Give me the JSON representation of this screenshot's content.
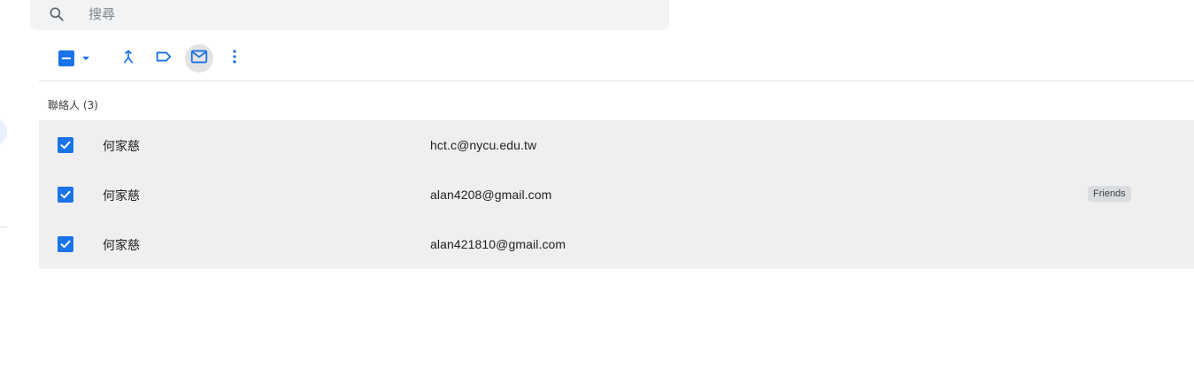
{
  "search": {
    "placeholder": "搜尋",
    "icon": "search-icon"
  },
  "toolbar": {
    "select_state": "indeterminate",
    "actions": [
      {
        "name": "merge-icon",
        "active": false
      },
      {
        "name": "label-icon",
        "active": false
      },
      {
        "name": "mail-icon",
        "active": true
      },
      {
        "name": "more-vert-icon",
        "active": false
      }
    ]
  },
  "section": {
    "heading": "聯絡人 (3)"
  },
  "contacts": [
    {
      "name": "何家慈",
      "email": "hct.c@nycu.edu.tw",
      "label": "",
      "selected": true
    },
    {
      "name": "何家慈",
      "email": "alan4208@gmail.com",
      "label": "Friends",
      "selected": true
    },
    {
      "name": "何家慈",
      "email": "alan421810@gmail.com",
      "label": "",
      "selected": true
    }
  ],
  "colors": {
    "accent": "#1a73e8",
    "selected_row_bg": "#efefef",
    "search_bg": "#f1f3f4",
    "chip_bg": "#dadce0"
  }
}
